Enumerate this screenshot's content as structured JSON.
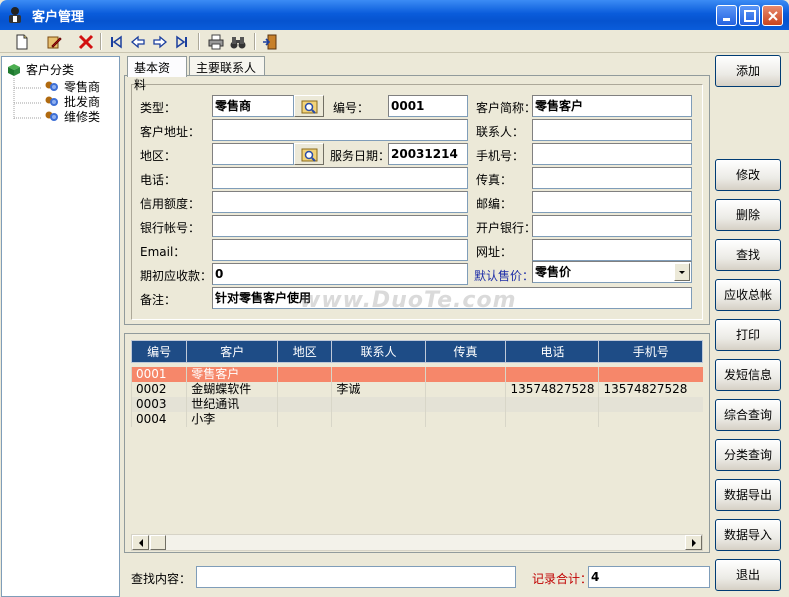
{
  "window": {
    "title": "客户管理"
  },
  "tree": {
    "root": "客户分类",
    "children": [
      "零售商",
      "批发商",
      "维修类"
    ]
  },
  "tabs": [
    "基本资料",
    "主要联系人"
  ],
  "form": {
    "type_label": "类型：",
    "type_value": "零售商",
    "code_label": "编号：",
    "code_value": "0001",
    "short_name_label": "客户简称：",
    "short_name_value": "零售客户",
    "address_label": "客户地址：",
    "address_value": "",
    "contact_label": "联系人：",
    "contact_value": "",
    "region_label": "地区：",
    "region_value": "",
    "service_date_label": "服务日期：",
    "service_date_value": "20031214",
    "mobile_label": "手机号：",
    "mobile_value": "",
    "phone_label": "电话：",
    "phone_value": "",
    "fax_label": "传真：",
    "fax_value": "",
    "credit_label": "信用额度：",
    "credit_value": "",
    "postcode_label": "邮编：",
    "postcode_value": "",
    "bank_account_label": "银行帐号：",
    "bank_account_value": "",
    "bank_label": "开户银行：",
    "bank_value": "",
    "email_label": "Email：",
    "email_value": "",
    "website_label": "网址：",
    "website_value": "",
    "initial_ar_label": "期初应收款：",
    "initial_ar_value": "0",
    "default_price_label": "默认售价：",
    "default_price_value": "零售价",
    "remark_label": "备注：",
    "remark_value": "针对零售客户使用"
  },
  "watermark": "www.DuoTe.com",
  "grid": {
    "columns": [
      "编号",
      "客户",
      "地区",
      "联系人",
      "传真",
      "电话",
      "手机号"
    ],
    "rows": [
      [
        "0001",
        "零售客户",
        "",
        "",
        "",
        "",
        ""
      ],
      [
        "0002",
        "金蝴蝶软件",
        "",
        "李诚",
        "",
        "13574827528",
        "13574827528"
      ],
      [
        "0003",
        "世纪通讯",
        "",
        "",
        "",
        "",
        ""
      ],
      [
        "0004",
        "小李",
        "",
        "",
        "",
        "",
        ""
      ]
    ]
  },
  "buttons": {
    "add": "添加",
    "edit": "修改",
    "delete": "删除",
    "find": "查找",
    "ar_summary": "应收总帐",
    "print": "打印",
    "sms": "发短信息",
    "combined_query": "综合查询",
    "category_query": "分类查询",
    "export": "数据导出",
    "import": "数据导入",
    "exit": "退出"
  },
  "footer": {
    "search_label": "查找内容：",
    "search_value": "",
    "count_label": "记录合计：",
    "count_value": "4"
  }
}
